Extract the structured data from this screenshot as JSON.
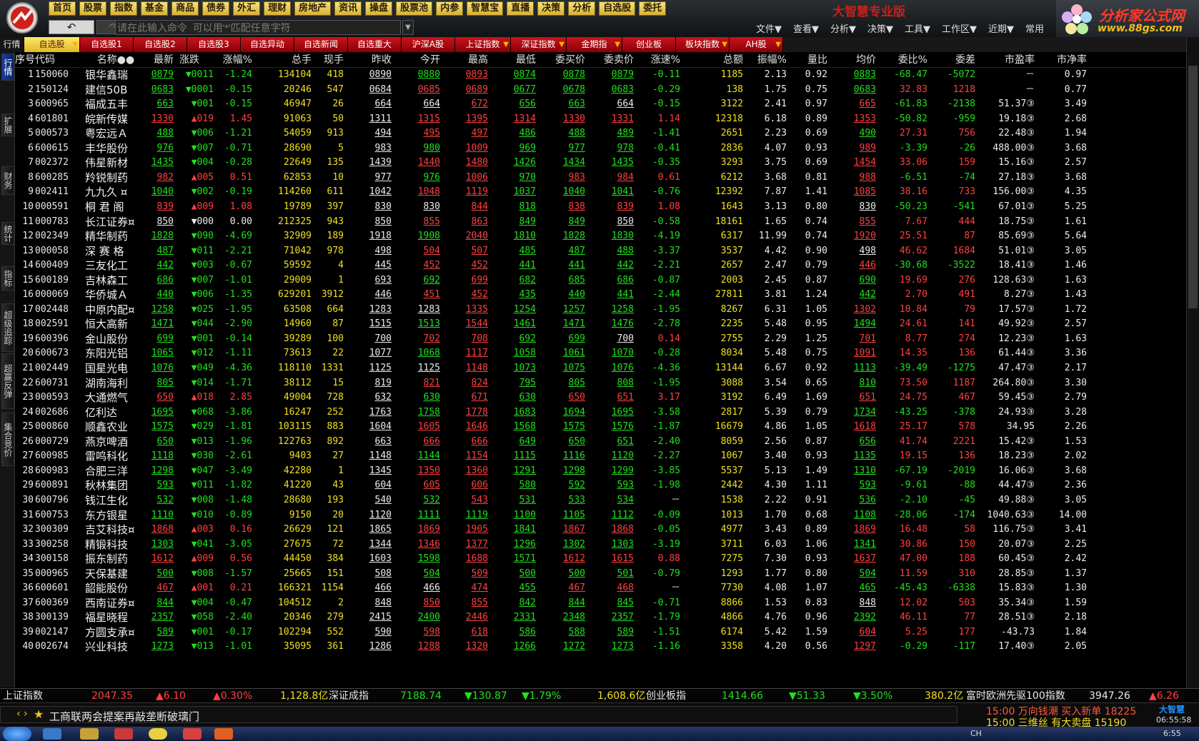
{
  "topmenu": [
    "首页",
    "股票",
    "指数",
    "基金",
    "商品",
    "债券",
    "外汇",
    "理财",
    "房地产",
    "资讯",
    "操盘",
    "股票池",
    "内参",
    "智慧宝",
    "直播",
    "决策",
    "分析",
    "自选股",
    "委托"
  ],
  "brand_title": "大智慧专业版",
  "nav": {
    "back_icon": "↶",
    "fwd_icon": "↷"
  },
  "command": {
    "placeholder": "请在此输入命令  可以用'*'匹配任意字符"
  },
  "rightmenu": [
    "文件▼",
    "查看▼",
    "分析▼",
    "决策▼",
    "工具▼",
    "工作区▼",
    "近期▼",
    "常用"
  ],
  "ad": {
    "title": "分析家公式网",
    "url": "www.88gs.com"
  },
  "tab_label": "行情",
  "tabs": [
    {
      "label": "自选股",
      "active": true,
      "arrow": true
    },
    {
      "label": "自选股1"
    },
    {
      "label": "自选股2"
    },
    {
      "label": "自选股3"
    },
    {
      "label": "自选异动"
    },
    {
      "label": "自选新闻"
    },
    {
      "label": "自选重大"
    },
    {
      "label": "沪深A股"
    },
    {
      "label": "上证指数",
      "arrow": true
    },
    {
      "label": "深证指数",
      "arrow": true
    },
    {
      "label": "金期指",
      "arrow": true
    },
    {
      "label": "创业板"
    },
    {
      "label": "板块指数",
      "arrow": true
    },
    {
      "label": "AH股",
      "arrow": true
    }
  ],
  "vtabs": [
    "行情",
    "扩展",
    "财务",
    "统计",
    "指标",
    "超级追踪",
    "超赢反弹",
    "集合竞价"
  ],
  "columns": [
    "序号",
    "代码",
    "名称●●",
    "最新",
    "涨跌",
    "涨幅%",
    "总手",
    "现手",
    "昨收",
    "今开",
    "最高",
    "最低",
    "委买价",
    "委卖价",
    "涨速%",
    "总额",
    "振幅%",
    "量比",
    "均价",
    "委比%",
    "委差",
    "市盈率",
    "市净率"
  ],
  "rows": [
    [
      "1",
      "150060",
      "银华鑫瑞",
      "0879",
      "▼0011",
      "-1.24",
      "134104",
      "418",
      "0890",
      "0880",
      "0893",
      "0874",
      "0878",
      "0879",
      "-0.11",
      "1185",
      "2.13",
      "0.92",
      "0883",
      "-68.47",
      "-5072",
      "－",
      "0.97"
    ],
    [
      "2",
      "150124",
      "建信50B",
      "0683",
      "▼0001",
      "-0.15",
      "20246",
      "547",
      "0684",
      "0685",
      "0689",
      "0677",
      "0678",
      "0683",
      "-0.29",
      "138",
      "1.75",
      "0.75",
      "0683",
      "32.83",
      "1218",
      "－",
      "0.77"
    ],
    [
      "3",
      "600965",
      "福成五丰",
      "663",
      "▼001",
      "-0.15",
      "46947",
      "26",
      "664",
      "664",
      "672",
      "656",
      "663",
      "664",
      "-0.15",
      "3122",
      "2.41",
      "0.97",
      "665",
      "-61.83",
      "-2138",
      "51.37③",
      "3.49"
    ],
    [
      "4",
      "601801",
      "皖新传媒",
      "1330",
      "▲019",
      "1.45",
      "91063",
      "50",
      "1311",
      "1315",
      "1395",
      "1314",
      "1330",
      "1331",
      "1.14",
      "12318",
      "6.18",
      "0.89",
      "1353",
      "-50.82",
      "-959",
      "19.18③",
      "2.68"
    ],
    [
      "5",
      "000573",
      "粤宏远Ａ",
      "488",
      "▼006",
      "-1.21",
      "54059",
      "913",
      "494",
      "495",
      "497",
      "486",
      "488",
      "489",
      "-1.41",
      "2651",
      "2.23",
      "0.69",
      "490",
      "27.31",
      "756",
      "22.48③",
      "1.94"
    ],
    [
      "6",
      "600615",
      "丰华股份",
      "976",
      "▼007",
      "-0.71",
      "28690",
      "5",
      "983",
      "980",
      "1009",
      "969",
      "977",
      "978",
      "-0.41",
      "2836",
      "4.07",
      "0.93",
      "989",
      "-3.39",
      "-26",
      "488.00③",
      "3.68"
    ],
    [
      "7",
      "002372",
      "伟星新材",
      "1435",
      "▼004",
      "-0.28",
      "22649",
      "135",
      "1439",
      "1440",
      "1480",
      "1426",
      "1434",
      "1435",
      "-0.35",
      "3293",
      "3.75",
      "0.69",
      "1454",
      "33.06",
      "159",
      "15.16③",
      "2.57"
    ],
    [
      "8",
      "600285",
      "羚锐制药",
      "982",
      "▲005",
      "0.51",
      "62853",
      "10",
      "977",
      "976",
      "1006",
      "970",
      "983",
      "984",
      "0.61",
      "6212",
      "3.68",
      "0.81",
      "988",
      "-6.51",
      "-74",
      "27.18③",
      "3.68"
    ],
    [
      "9",
      "002411",
      "九九久 ¤",
      "1040",
      "▼002",
      "-0.19",
      "114260",
      "611",
      "1042",
      "1048",
      "1119",
      "1037",
      "1040",
      "1041",
      "-0.76",
      "12392",
      "7.87",
      "1.41",
      "1085",
      "38.16",
      "733",
      "156.00③",
      "4.35"
    ],
    [
      "10",
      "000591",
      "桐 君 阁",
      "839",
      "▲009",
      "1.08",
      "19789",
      "397",
      "830",
      "830",
      "844",
      "818",
      "838",
      "839",
      "1.08",
      "1643",
      "3.13",
      "0.80",
      "830",
      "-50.23",
      "-541",
      "67.01③",
      "5.25"
    ],
    [
      "11",
      "000783",
      "长江证券¤",
      "850",
      "▼000",
      "0.00",
      "212325",
      "943",
      "850",
      "855",
      "863",
      "849",
      "849",
      "850",
      "-0.58",
      "18161",
      "1.65",
      "0.74",
      "855",
      "7.67",
      "444",
      "18.75③",
      "1.61"
    ],
    [
      "12",
      "002349",
      "精华制药",
      "1828",
      "▼090",
      "-4.69",
      "32909",
      "189",
      "1918",
      "1908",
      "2040",
      "1810",
      "1828",
      "1830",
      "-4.19",
      "6317",
      "11.99",
      "0.74",
      "1920",
      "25.51",
      "87",
      "85.69③",
      "5.64"
    ],
    [
      "13",
      "000058",
      "深 赛 格",
      "487",
      "▼011",
      "-2.21",
      "71042",
      "978",
      "498",
      "504",
      "507",
      "485",
      "487",
      "488",
      "-3.37",
      "3537",
      "4.42",
      "0.90",
      "498",
      "46.62",
      "1684",
      "51.01③",
      "3.05"
    ],
    [
      "14",
      "600409",
      "三友化工",
      "442",
      "▼003",
      "-0.67",
      "59592",
      "4",
      "445",
      "452",
      "452",
      "441",
      "441",
      "442",
      "-2.21",
      "2657",
      "2.47",
      "0.79",
      "446",
      "-30.68",
      "-3522",
      "18.41③",
      "1.46"
    ],
    [
      "15",
      "600189",
      "吉林森工",
      "686",
      "▼007",
      "-1.01",
      "29009",
      "1",
      "693",
      "692",
      "699",
      "682",
      "685",
      "686",
      "-0.87",
      "2003",
      "2.45",
      "0.87",
      "690",
      "19.69",
      "276",
      "128.63③",
      "1.63"
    ],
    [
      "16",
      "000069",
      "华侨城Ａ",
      "440",
      "▼006",
      "-1.35",
      "629201",
      "3912",
      "446",
      "451",
      "452",
      "435",
      "440",
      "441",
      "-2.44",
      "27811",
      "3.81",
      "1.24",
      "442",
      "2.70",
      "491",
      "8.27③",
      "1.43"
    ],
    [
      "17",
      "002448",
      "中原内配¤",
      "1258",
      "▼025",
      "-1.95",
      "63508",
      "664",
      "1283",
      "1283",
      "1335",
      "1254",
      "1257",
      "1258",
      "-1.95",
      "8267",
      "6.31",
      "1.05",
      "1302",
      "10.84",
      "79",
      "17.57③",
      "1.72"
    ],
    [
      "18",
      "002591",
      "恒大高新",
      "1471",
      "▼044",
      "-2.90",
      "14960",
      "87",
      "1515",
      "1513",
      "1544",
      "1461",
      "1471",
      "1476",
      "-2.78",
      "2235",
      "5.48",
      "0.95",
      "1494",
      "24.61",
      "141",
      "49.92③",
      "2.57"
    ],
    [
      "19",
      "600396",
      "金山股份",
      "699",
      "▼001",
      "-0.14",
      "39289",
      "100",
      "700",
      "702",
      "708",
      "692",
      "699",
      "700",
      "0.14",
      "2755",
      "2.29",
      "1.25",
      "701",
      "8.77",
      "274",
      "12.23③",
      "1.63"
    ],
    [
      "20",
      "600673",
      "东阳光铝",
      "1065",
      "▼012",
      "-1.11",
      "73613",
      "22",
      "1077",
      "1068",
      "1117",
      "1058",
      "1061",
      "1070",
      "-0.28",
      "8034",
      "5.48",
      "0.75",
      "1091",
      "14.35",
      "136",
      "61.44③",
      "3.36"
    ],
    [
      "21",
      "002449",
      "国星光电",
      "1076",
      "▼049",
      "-4.36",
      "118110",
      "1331",
      "1125",
      "1125",
      "1148",
      "1073",
      "1075",
      "1076",
      "-4.36",
      "13144",
      "6.67",
      "0.92",
      "1113",
      "-39.49",
      "-1275",
      "47.47③",
      "2.17"
    ],
    [
      "22",
      "600731",
      "湖南海利",
      "805",
      "▼014",
      "-1.71",
      "38112",
      "15",
      "819",
      "821",
      "824",
      "795",
      "805",
      "808",
      "-1.95",
      "3088",
      "3.54",
      "0.65",
      "810",
      "73.50",
      "1187",
      "264.80③",
      "3.30"
    ],
    [
      "23",
      "000593",
      "大通燃气",
      "650",
      "▲018",
      "2.85",
      "49004",
      "728",
      "632",
      "630",
      "671",
      "630",
      "650",
      "651",
      "3.17",
      "3192",
      "6.49",
      "1.69",
      "651",
      "24.75",
      "467",
      "59.45③",
      "2.79"
    ],
    [
      "24",
      "002686",
      "亿利达",
      "1695",
      "▼068",
      "-3.86",
      "16247",
      "252",
      "1763",
      "1758",
      "1778",
      "1683",
      "1694",
      "1695",
      "-3.58",
      "2817",
      "5.39",
      "0.79",
      "1734",
      "-43.25",
      "-378",
      "24.93③",
      "3.28"
    ],
    [
      "25",
      "000860",
      "顺鑫农业",
      "1575",
      "▼029",
      "-1.81",
      "103115",
      "883",
      "1604",
      "1605",
      "1646",
      "1568",
      "1575",
      "1576",
      "-1.87",
      "16679",
      "4.86",
      "1.05",
      "1618",
      "25.17",
      "578",
      "34.95",
      "2.26"
    ],
    [
      "26",
      "000729",
      "燕京啤酒",
      "650",
      "▼013",
      "-1.96",
      "122763",
      "892",
      "663",
      "666",
      "666",
      "649",
      "650",
      "651",
      "-2.40",
      "8059",
      "2.56",
      "0.87",
      "656",
      "41.74",
      "2221",
      "15.42③",
      "1.53"
    ],
    [
      "27",
      "600985",
      "雷鸣科化",
      "1118",
      "▼030",
      "-2.61",
      "9403",
      "27",
      "1148",
      "1144",
      "1154",
      "1115",
      "1116",
      "1120",
      "-2.27",
      "1067",
      "3.40",
      "0.93",
      "1135",
      "19.15",
      "136",
      "18.23③",
      "2.02"
    ],
    [
      "28",
      "600983",
      "合肥三洋",
      "1298",
      "▼047",
      "-3.49",
      "42280",
      "1",
      "1345",
      "1350",
      "1360",
      "1291",
      "1298",
      "1299",
      "-3.85",
      "5537",
      "5.13",
      "1.49",
      "1310",
      "-67.19",
      "-2019",
      "16.06③",
      "3.68"
    ],
    [
      "29",
      "600891",
      "秋林集团",
      "593",
      "▼011",
      "-1.82",
      "41220",
      "43",
      "604",
      "605",
      "606",
      "580",
      "592",
      "593",
      "-1.98",
      "2442",
      "4.30",
      "1.11",
      "593",
      "-9.61",
      "-88",
      "44.47③",
      "2.36"
    ],
    [
      "30",
      "600796",
      "钱江生化",
      "532",
      "▼008",
      "-1.48",
      "28680",
      "193",
      "540",
      "532",
      "543",
      "531",
      "533",
      "534",
      "－",
      "1538",
      "2.22",
      "0.91",
      "536",
      "-2.10",
      "-45",
      "49.88③",
      "3.05"
    ],
    [
      "31",
      "600753",
      "东方银星",
      "1110",
      "▼010",
      "-0.89",
      "9150",
      "20",
      "1120",
      "1111",
      "1119",
      "1100",
      "1105",
      "1112",
      "-0.09",
      "1013",
      "1.70",
      "0.68",
      "1108",
      "-28.06",
      "-174",
      "1040.63③",
      "14.00"
    ],
    [
      "32",
      "300309",
      "吉艾科技¤",
      "1868",
      "▲003",
      "0.16",
      "26629",
      "121",
      "1865",
      "1869",
      "1905",
      "1841",
      "1867",
      "1868",
      "-0.05",
      "4977",
      "3.43",
      "0.89",
      "1869",
      "16.48",
      "58",
      "116.75③",
      "3.41"
    ],
    [
      "33",
      "300258",
      "精锻科技",
      "1303",
      "▼041",
      "-3.05",
      "27675",
      "72",
      "1344",
      "1346",
      "1377",
      "1296",
      "1302",
      "1303",
      "-3.19",
      "3711",
      "6.03",
      "1.06",
      "1341",
      "30.86",
      "150",
      "20.07③",
      "2.25"
    ],
    [
      "34",
      "300158",
      "振东制药",
      "1612",
      "▲009",
      "0.56",
      "44450",
      "384",
      "1603",
      "1598",
      "1688",
      "1571",
      "1612",
      "1615",
      "0.88",
      "7275",
      "7.30",
      "0.93",
      "1637",
      "47.00",
      "188",
      "60.45③",
      "2.42"
    ],
    [
      "35",
      "000965",
      "天保基建",
      "500",
      "▼008",
      "-1.57",
      "25665",
      "151",
      "508",
      "504",
      "509",
      "500",
      "500",
      "501",
      "-0.79",
      "1293",
      "1.77",
      "0.80",
      "504",
      "11.59",
      "310",
      "28.85③",
      "1.37"
    ],
    [
      "36",
      "600601",
      "韶能股份",
      "467",
      "▲001",
      "0.21",
      "166321",
      "1154",
      "466",
      "466",
      "474",
      "455",
      "467",
      "468",
      "－",
      "7730",
      "4.08",
      "1.07",
      "465",
      "-45.43",
      "-6338",
      "15.83③",
      "1.30"
    ],
    [
      "37",
      "600369",
      "西南证券¤",
      "844",
      "▼004",
      "-0.47",
      "104512",
      "2",
      "848",
      "850",
      "855",
      "842",
      "844",
      "845",
      "-0.71",
      "8866",
      "1.53",
      "0.83",
      "848",
      "12.02",
      "503",
      "35.34③",
      "1.59"
    ],
    [
      "38",
      "300139",
      "福星晓程",
      "2357",
      "▼058",
      "-2.40",
      "20346",
      "279",
      "2415",
      "2400",
      "2446",
      "2331",
      "2348",
      "2357",
      "-1.79",
      "4866",
      "4.76",
      "0.96",
      "2392",
      "46.11",
      "77",
      "28.51③",
      "2.18"
    ],
    [
      "39",
      "002147",
      "方圆支承¤",
      "589",
      "▼001",
      "-0.17",
      "102294",
      "552",
      "590",
      "598",
      "618",
      "586",
      "588",
      "589",
      "-1.51",
      "6174",
      "5.42",
      "1.59",
      "604",
      "5.25",
      "177",
      "-43.73",
      "1.84"
    ],
    [
      "40",
      "002674",
      "兴业科技",
      "1273",
      "▼013",
      "-1.01",
      "35095",
      "361",
      "1286",
      "1288",
      "1320",
      "1266",
      "1272",
      "1273",
      "-1.16",
      "3358",
      "4.20",
      "0.56",
      "1297",
      "-0.29",
      "-117",
      "17.40③",
      "2.05"
    ]
  ],
  "indices": [
    {
      "name": "上证指数",
      "price": "2047.35",
      "chg": "▲6.10",
      "pct": "▲0.30%",
      "amt": "1,128.8亿"
    },
    {
      "name": "深证成指",
      "price": "7188.74",
      "chg": "▼130.87",
      "pct": "▼1.79%",
      "amt": "1,608.6亿"
    },
    {
      "name": "创业板指",
      "price": "1414.66",
      "chg": "▼51.33",
      "pct": "▼3.50%",
      "amt": "380.2亿"
    },
    {
      "name": "富时欧洲先驱100指数",
      "price": "3947.26",
      "chg": "▲6.26"
    }
  ],
  "news": {
    "headline": "工商联两会提案再敲垄断破璃门",
    "line1": "15:00 万向钱潮 买入新单 18225",
    "line2": "15:00 三维丝  有大卖盘 15190",
    "clock": "06:55:58",
    "brand": "大智慧"
  },
  "taskbar": {
    "clock": "6:55",
    "lang": "CH"
  }
}
